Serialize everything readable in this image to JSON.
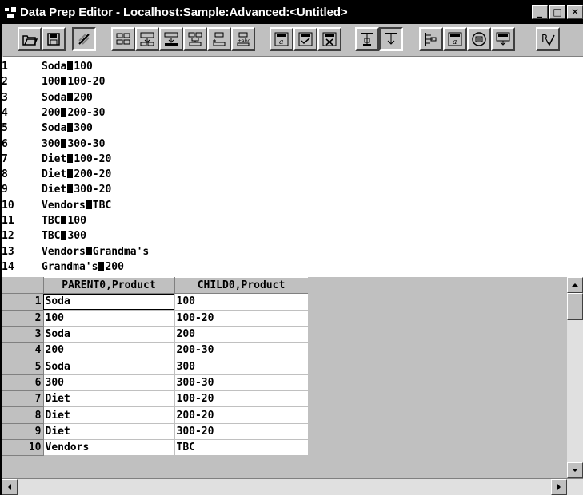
{
  "window": {
    "title": "Data Prep Editor - Localhost:Sample:Advanced:<Untitled>",
    "controls": {
      "minimize": "_",
      "restore": "□",
      "close": "✕"
    }
  },
  "toolbar": {
    "buttons": [
      {
        "icon": "open-file-icon"
      },
      {
        "icon": "save-icon"
      },
      {
        "icon": "clear-icon"
      },
      {
        "icon": "field-properties-icon"
      },
      {
        "icon": "split-field-icon"
      },
      {
        "icon": "move-field-icon"
      },
      {
        "icon": "join-fields-icon"
      },
      {
        "icon": "create-field-icon"
      },
      {
        "icon": "create-field-text-icon"
      },
      {
        "icon": "data-file-properties-icon"
      },
      {
        "icon": "ignore-field-icon"
      },
      {
        "icon": "dimension-build-icon"
      },
      {
        "icon": "data-load-icon"
      },
      {
        "icon": "dimension-build-settings-icon"
      },
      {
        "icon": "data-load-settings-icon"
      },
      {
        "icon": "view-field-icon"
      },
      {
        "icon": "view-data-icon"
      },
      {
        "icon": "validate-icon"
      }
    ]
  },
  "text_pane": {
    "lines": [
      {
        "n": "1",
        "a": "Soda",
        "b": "100"
      },
      {
        "n": "2",
        "a": "100",
        "b": "100-20"
      },
      {
        "n": "3",
        "a": "Soda",
        "b": "200"
      },
      {
        "n": "4",
        "a": "200",
        "b": "200-30"
      },
      {
        "n": "5",
        "a": "Soda",
        "b": "300"
      },
      {
        "n": "6",
        "a": "300",
        "b": "300-30"
      },
      {
        "n": "7",
        "a": "Diet",
        "b": "100-20"
      },
      {
        "n": "8",
        "a": "Diet",
        "b": "200-20"
      },
      {
        "n": "9",
        "a": "Diet",
        "b": "300-20"
      },
      {
        "n": "10",
        "a": "Vendors",
        "b": "TBC"
      },
      {
        "n": "11",
        "a": "TBC",
        "b": "100"
      },
      {
        "n": "12",
        "a": "TBC",
        "b": "300"
      },
      {
        "n": "13",
        "a": "Vendors",
        "b": "Grandma's"
      },
      {
        "n": "14",
        "a": "Grandma's",
        "b": "200"
      }
    ]
  },
  "grid": {
    "columns": [
      "PARENT0,Product",
      "CHILD0,Product"
    ],
    "rows": [
      {
        "n": "1",
        "c1": "Soda",
        "c2": "100"
      },
      {
        "n": "2",
        "c1": "100",
        "c2": "100-20"
      },
      {
        "n": "3",
        "c1": "Soda",
        "c2": "200"
      },
      {
        "n": "4",
        "c1": "200",
        "c2": "200-30"
      },
      {
        "n": "5",
        "c1": "Soda",
        "c2": "300"
      },
      {
        "n": "6",
        "c1": "300",
        "c2": "300-30"
      },
      {
        "n": "7",
        "c1": "Diet",
        "c2": "100-20"
      },
      {
        "n": "8",
        "c1": "Diet",
        "c2": "200-20"
      },
      {
        "n": "9",
        "c1": "Diet",
        "c2": "300-20"
      },
      {
        "n": "10",
        "c1": "Vendors",
        "c2": "TBC"
      }
    ]
  }
}
